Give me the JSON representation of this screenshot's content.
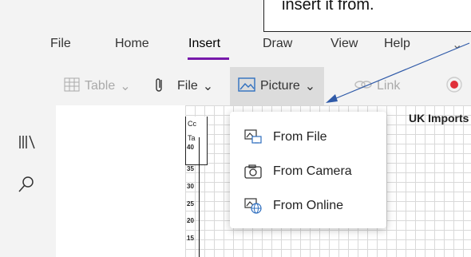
{
  "callout": {
    "text": "insert it from."
  },
  "menu": {
    "file": "File",
    "home": "Home",
    "insert": "Insert",
    "draw": "Draw",
    "view": "View",
    "help": "Help"
  },
  "ribbon": {
    "table": "Table",
    "file": "File",
    "picture": "Picture",
    "link": "Link"
  },
  "canvas": {
    "heading": "UK Imports",
    "cells": [
      "Cc",
      "Ta"
    ],
    "y_ticks": [
      "40",
      "35",
      "30",
      "25",
      "20",
      "15"
    ]
  },
  "dropdown": {
    "items": [
      "From File",
      "From Camera",
      "From Online"
    ]
  },
  "colors": {
    "accent": "#7719aa",
    "arrow": "#2f5aa8",
    "record": "#e0303a"
  }
}
